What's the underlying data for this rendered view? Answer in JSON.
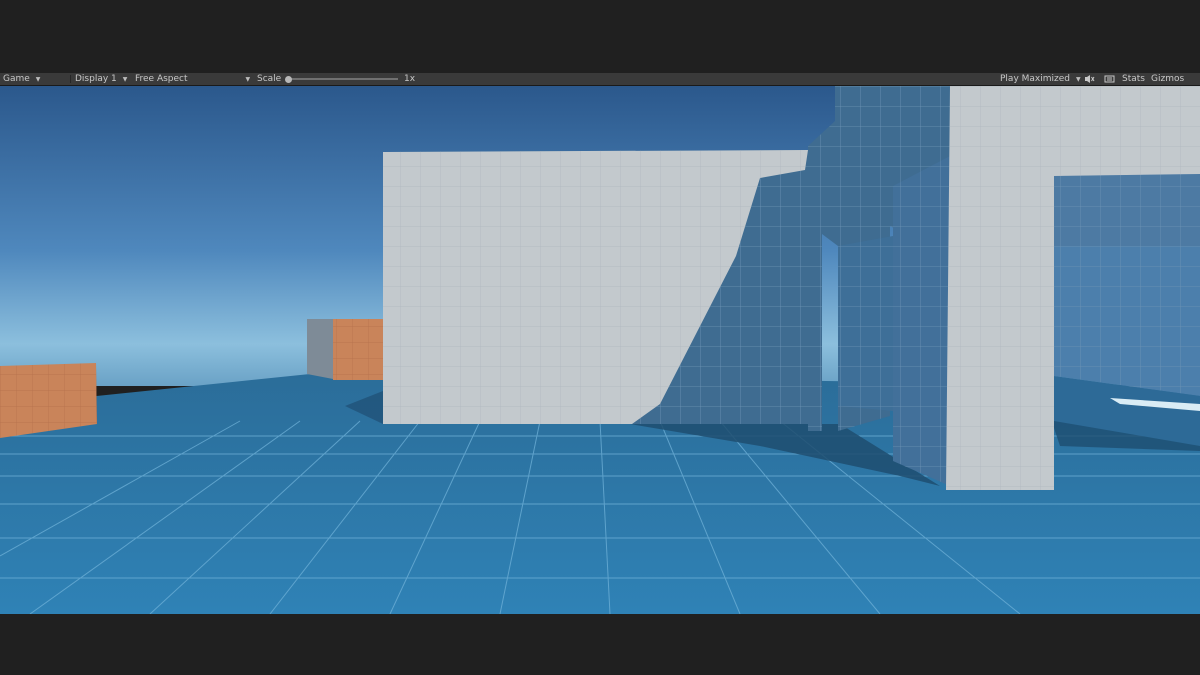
{
  "toolbar": {
    "view_label": "Game",
    "display_label": "Display 1",
    "aspect_label": "Free Aspect",
    "scale_label": "Scale",
    "scale_value": "1x",
    "play_mode_label": "Play Maximized",
    "stats_label": "Stats",
    "gizmos_label": "Gizmos"
  },
  "colors": {
    "sky_top": "#2c5a8e",
    "sky_horizon": "#9cc8e0",
    "floor": "#2a6f9c",
    "wall_lit": "#c3c9cd",
    "wall_shadow": "#3f6c91",
    "crate": "#c9845a"
  },
  "icons": [
    "dropdown-caret-icon",
    "audio-mute-icon",
    "stats-icon"
  ]
}
